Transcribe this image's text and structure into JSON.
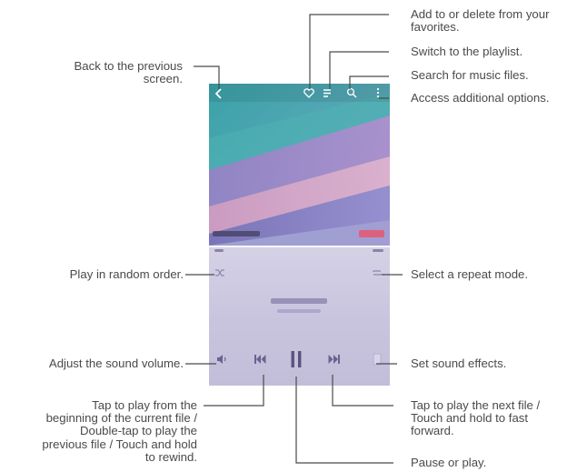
{
  "callouts": {
    "favorites": "Add to or delete from your favorites.",
    "playlist": "Switch to the playlist.",
    "search": "Search for music files.",
    "options": "Access additional options.",
    "back_line1": "Back to the previous",
    "back_line2": "screen.",
    "random": "Play in random order.",
    "repeat": "Select a repeat mode.",
    "volume": "Adjust the sound volume.",
    "effects": "Set sound effects.",
    "prev_line1": "Tap to play from the",
    "prev_line2": "beginning of the current file /",
    "prev_line3": "Double-tap to play the",
    "prev_line4": "previous file / Touch and hold",
    "prev_line5": "to rewind.",
    "next_line1": "Tap to play the next file /",
    "next_line2": "Touch and hold to fast",
    "next_line3": "forward.",
    "pause": "Pause or play."
  },
  "icons": {
    "back": "back-arrow-icon",
    "favorite": "heart-icon",
    "playlist": "playlist-icon",
    "search": "search-icon",
    "options": "more-options-icon",
    "shuffle": "shuffle-icon",
    "repeat": "repeat-icon",
    "volume": "volume-icon",
    "previous": "previous-track-icon",
    "pause": "pause-icon",
    "next": "next-track-icon",
    "effects": "sound-effects-icon"
  },
  "colors": {
    "text": "#4a4a4a",
    "leader": "#4a4a4a",
    "artwork_teal": "#3f9fae",
    "artwork_purple": "#8e7cc3",
    "artwork_pink": "#d9a0c4",
    "player_lower": "#c9c5df",
    "controls": "#6a6290",
    "accent": "#e8566f"
  }
}
